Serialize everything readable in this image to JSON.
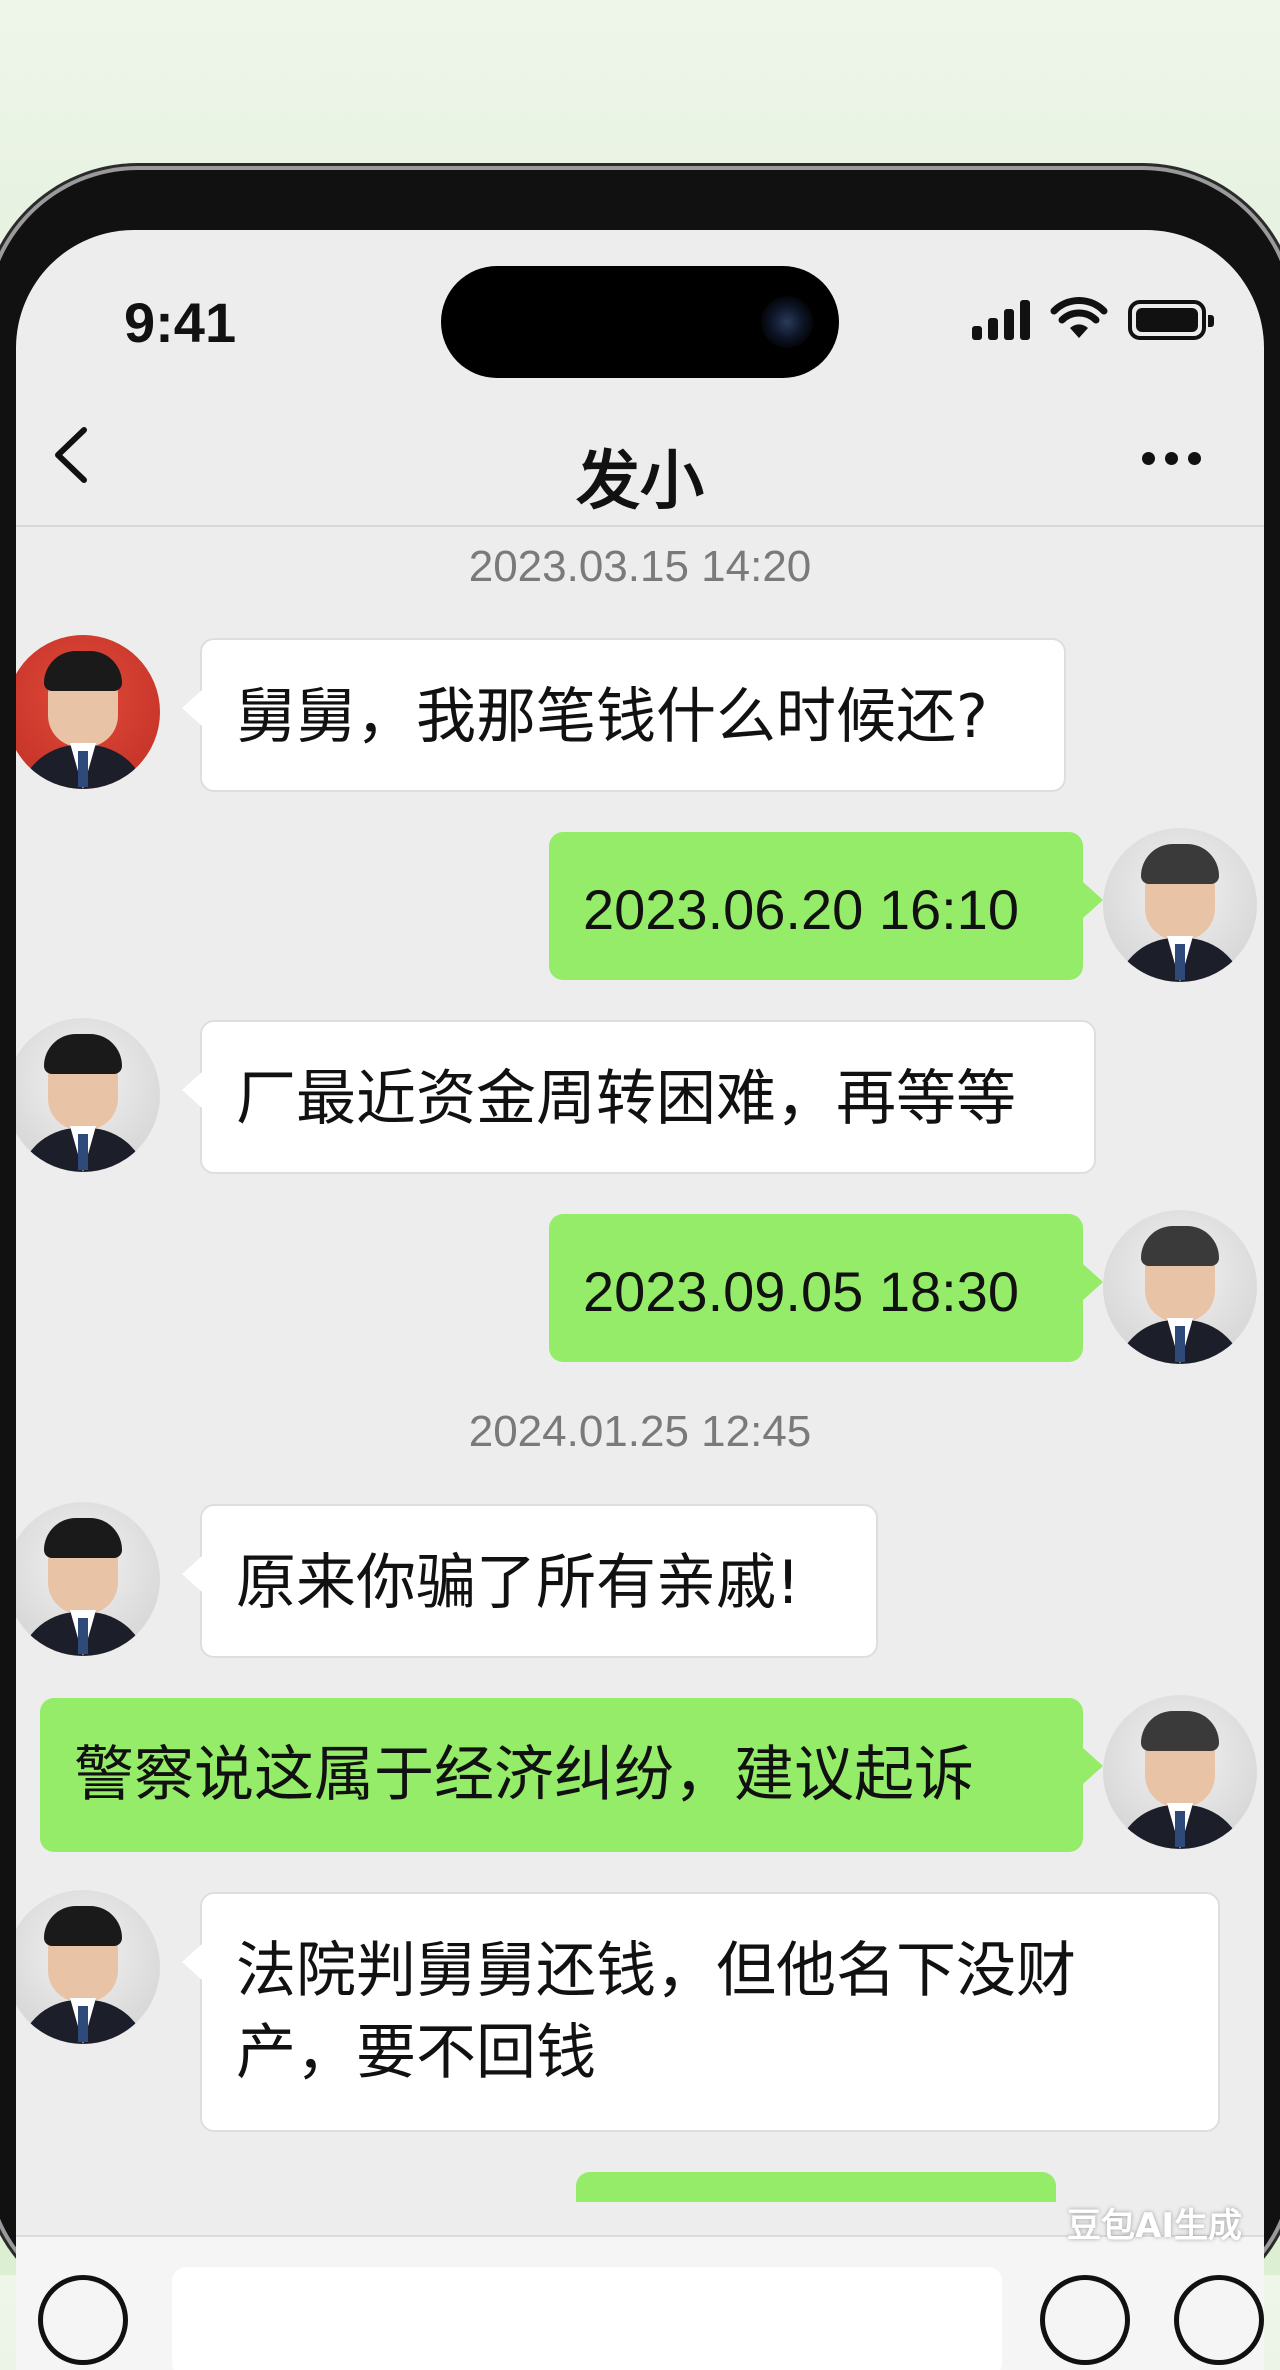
{
  "status_bar": {
    "time": "9:41"
  },
  "nav": {
    "title": "发小"
  },
  "messages": [
    {
      "type": "timestamp",
      "text": "2023.03.15 14:20"
    },
    {
      "type": "incoming",
      "avatar": "red-bg-young-man",
      "text": "舅舅，我那笔钱什么时候还?"
    },
    {
      "type": "outgoing",
      "avatar": "older-man",
      "text": "2023.06.20 16:10"
    },
    {
      "type": "incoming",
      "avatar": "young-man",
      "text": "厂最近资金周转困难，再等等"
    },
    {
      "type": "outgoing",
      "avatar": "older-man",
      "text": "2023.09.05 18:30"
    },
    {
      "type": "timestamp",
      "text": "2024.01.25 12:45"
    },
    {
      "type": "incoming",
      "avatar": "young-man",
      "text": "原来你骗了所有亲戚!"
    },
    {
      "type": "outgoing",
      "avatar": "older-man",
      "text": "警察说这属于经济纠纷，建议起诉"
    },
    {
      "type": "incoming",
      "avatar": "young-man",
      "text": "法院判舅舅还钱，但他名下没财产，要不回钱"
    }
  ],
  "input_bar": {
    "placeholder": ""
  },
  "watermark": "豆包AI生成",
  "colors": {
    "outgoing_bubble": "#95ec69",
    "incoming_bubble": "#ffffff",
    "chat_background": "#ededed"
  }
}
